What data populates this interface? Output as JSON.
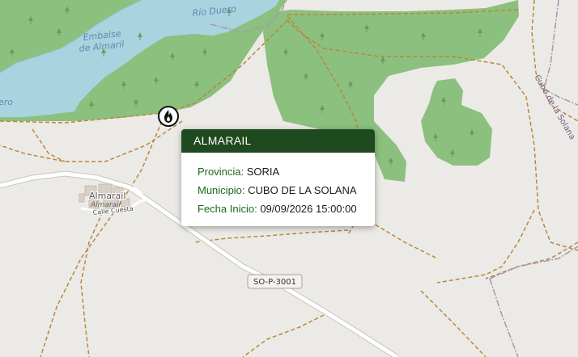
{
  "map": {
    "labels": {
      "river": "Río Duero",
      "reservoir_line1": "Embalse",
      "reservoir_line2": "de Almaril",
      "river_left_fragment": "ero",
      "village_main": "Almarail",
      "village_sub": "Almarail",
      "street": "Calle Cuesta",
      "road_shield": "SO-P-3001",
      "town_right": "Cubo de la Solana"
    },
    "colors": {
      "background": "#eceae6",
      "forest": "#8cc07f",
      "water": "#a9d3df",
      "track": "#b8883c",
      "road": "#ffffff",
      "boundary": "#a795b3"
    }
  },
  "marker": {
    "icon": "fire-icon",
    "type": "incendio"
  },
  "popup": {
    "title": "ALMARAIL",
    "header_color": "#1f4a1f",
    "rows": [
      {
        "label": "Provincia:",
        "value": "SORIA"
      },
      {
        "label": "Municipio:",
        "value": "CUBO DE LA SOLANA"
      },
      {
        "label": "Fecha Inicio:",
        "value": "09/09/2026 15:00:00"
      }
    ]
  }
}
